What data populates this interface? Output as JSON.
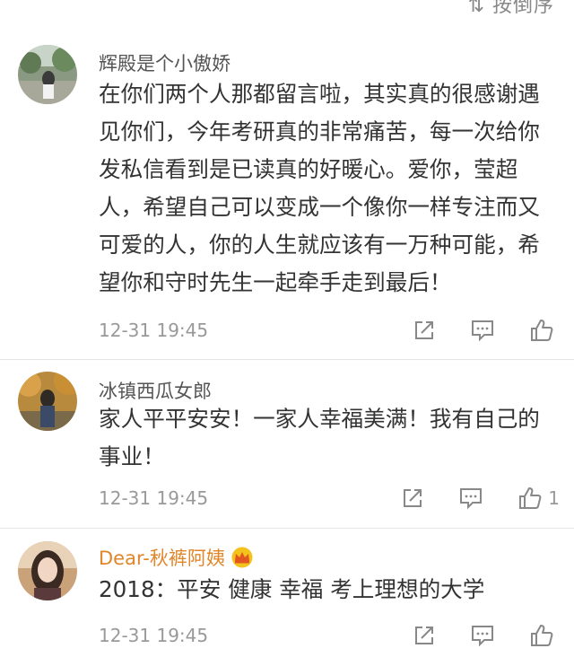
{
  "sort": {
    "label": "⇅ 按倒序"
  },
  "comments": [
    {
      "user": "辉殿是个小傲娇",
      "vip": false,
      "text": "在你们两个人那都留言啦，其实真的很感谢遇见你们，今年考研真的非常痛苦，每一次给你发私信看到是已读真的好暖心。爱你，莹超人，希望自己可以变成一个像你一样专注而又可爱的人，你的人生就应该有一万种可能，希望你和守时先生一起牵手走到最后！",
      "time": "12-31 19:45",
      "likes": "",
      "avatar_icon": "avatar-photo-outdoor"
    },
    {
      "user": "冰镇西瓜女郎",
      "vip": false,
      "text": "家人平平安安！一家人幸福美满！我有自己的事业！",
      "time": "12-31 19:45",
      "likes": "1",
      "avatar_icon": "avatar-photo-autumn"
    },
    {
      "user": "Dear-秋裤阿姨",
      "vip": true,
      "badge_icon": "crown-icon",
      "text": "2018：平安 健康 幸福 考上理想的大学",
      "time": "12-31 19:45",
      "likes": "",
      "avatar_icon": "avatar-photo-portrait"
    }
  ],
  "colors": {
    "vip_name": "#e0862b",
    "text": "#333333",
    "meta": "#999999",
    "icon": "#888888"
  }
}
